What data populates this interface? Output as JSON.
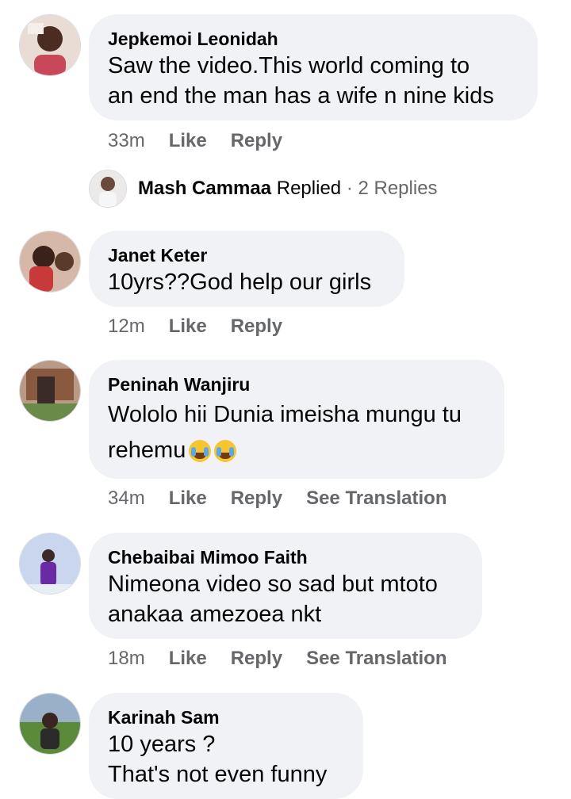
{
  "comments": [
    {
      "author": "Jepkemoi Leonidah",
      "lines": [
        "Saw the video.This world  coming to",
        "an end the man has a wife n nine kids"
      ],
      "time": "33m",
      "like": "Like",
      "reply": "Reply"
    },
    {
      "author": "Janet Keter",
      "lines": [
        "10yrs??God help our girls"
      ],
      "time": "12m",
      "like": "Like",
      "reply": "Reply"
    },
    {
      "author": "Peninah Wanjiru",
      "lines": [
        "Wololo hii Dunia imeisha mungu tu",
        "rehemu"
      ],
      "time": "34m",
      "like": "Like",
      "reply": "Reply",
      "translate": "See Translation",
      "emoji": [
        "loudly-crying-face",
        "loudly-crying-face"
      ]
    },
    {
      "author": "Chebaibai Mimoo Faith",
      "lines": [
        "Nimeona video so sad but mtoto",
        "anakaa amezoea nkt"
      ],
      "time": "18m",
      "like": "Like",
      "reply": "Reply",
      "translate": "See Translation"
    },
    {
      "author": "Karinah Sam",
      "lines": [
        "10 years ?",
        "That's not even funny"
      ]
    }
  ],
  "reply_summary": {
    "name": "Mash Cammaa",
    "verb": "Replied",
    "separator": "·",
    "count": "2 Replies"
  },
  "colors": {
    "bubble": "#f0f2f5",
    "secondary_text": "#65676b",
    "primary_text": "#050505"
  }
}
